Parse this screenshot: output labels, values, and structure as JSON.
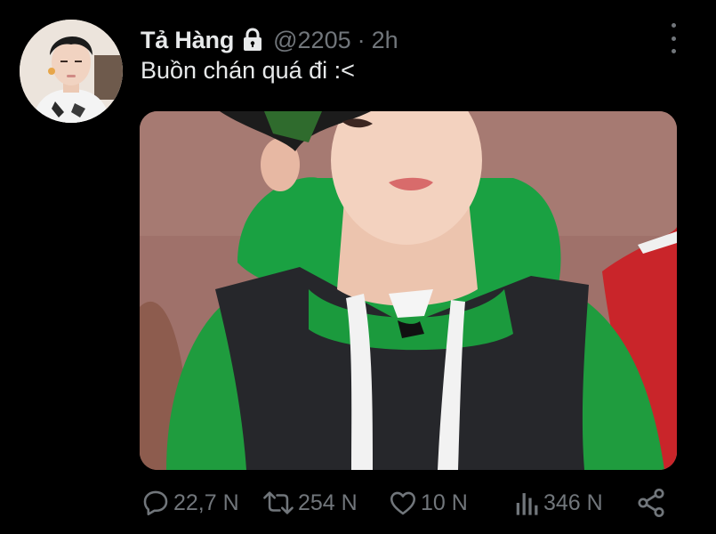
{
  "tweet": {
    "display_name": "Tả Hàng",
    "handle": "@2205",
    "separator": "·",
    "time": "2h",
    "text": "Buồn chán quá đi :<",
    "locked_icon": "lock-icon",
    "media_alt": "photo"
  },
  "actions": {
    "replies": "22,7 N",
    "retweets": "254 N",
    "likes": "10 N",
    "views": "346 N"
  },
  "colors": {
    "background": "#000000",
    "primary_text": "#e7e9ea",
    "secondary_text": "#71767b"
  }
}
